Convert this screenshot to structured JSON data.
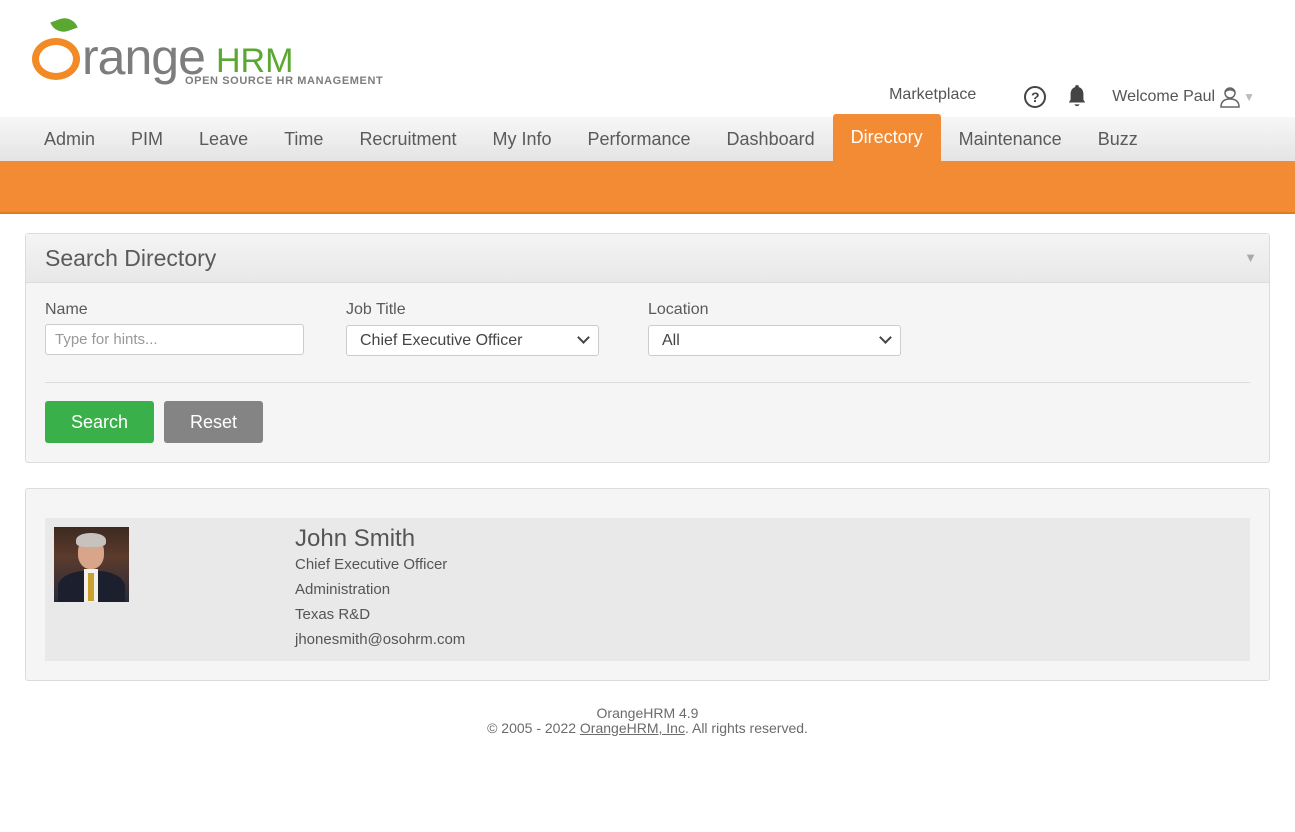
{
  "brand": {
    "logo_main": "range",
    "logo_accent": "HRM",
    "tagline": "OPEN SOURCE HR MANAGEMENT"
  },
  "topbar": {
    "marketplace": "Marketplace",
    "help_glyph": "?",
    "welcome": "Welcome Paul",
    "caret": "▼"
  },
  "nav": {
    "items": [
      {
        "label": "Admin"
      },
      {
        "label": "PIM"
      },
      {
        "label": "Leave"
      },
      {
        "label": "Time"
      },
      {
        "label": "Recruitment"
      },
      {
        "label": "My Info"
      },
      {
        "label": "Performance"
      },
      {
        "label": "Dashboard"
      },
      {
        "label": "Directory"
      },
      {
        "label": "Maintenance"
      },
      {
        "label": "Buzz"
      }
    ],
    "active": "Directory"
  },
  "search": {
    "title": "Search Directory",
    "collapse_glyph": "▼",
    "name_label": "Name",
    "name_placeholder": "Type for hints...",
    "name_value": "",
    "job_title_label": "Job Title",
    "job_title_value": "Chief Executive Officer",
    "location_label": "Location",
    "location_value": "All",
    "search_button": "Search",
    "reset_button": "Reset"
  },
  "results": [
    {
      "name": "John Smith",
      "job_title": "Chief Executive Officer",
      "department": "Administration",
      "location": "Texas R&D",
      "email": "jhonesmith@osohrm.com"
    }
  ],
  "footer": {
    "version": "OrangeHRM 4.9",
    "copyright_prefix": "© 2005 - 2022 ",
    "company_link": "OrangeHRM, Inc",
    "copyright_suffix": ". All rights reserved."
  },
  "colors": {
    "accent_orange": "#f28b34",
    "brand_green": "#5aa832",
    "search_green": "#3ab04a",
    "reset_gray": "#848484"
  }
}
